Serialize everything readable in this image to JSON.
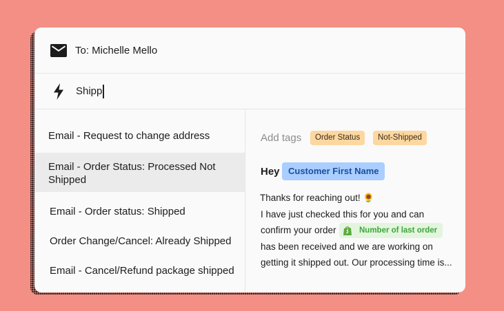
{
  "compose": {
    "to_label": "To: Michelle Mello",
    "search_value": "Shipp"
  },
  "templates": [
    {
      "label": "Email - Request to change address"
    },
    {
      "label": "Email - Order Status: Processed Not Shipped"
    },
    {
      "label": "Email - Order status: Shipped"
    },
    {
      "label": "Order Change/Cancel: Already Shipped"
    },
    {
      "label": "Email - Cancel/Refund package shipped"
    }
  ],
  "preview": {
    "tags_label": "Add tags",
    "tags": [
      "Order Status",
      "Not-Shipped"
    ],
    "greeting": "Hey",
    "customer_variable": "Customer First Name",
    "line1": "Thanks for reaching out! 🌻",
    "line2": "I have just checked this for you and can",
    "line3": "confirm your order",
    "order_variable": "Number of last order",
    "line4": "has been received and we are working on",
    "line5": "getting it shipped out. Our processing time is..."
  },
  "colors": {
    "background": "#f38f84",
    "tag": "#fcd79f",
    "customer_variable": "#a9ceff",
    "order_variable": "#e4f5df",
    "selected_row": "#ebebeb"
  },
  "icons": {
    "recipient": "mail-icon",
    "search": "lightning-icon",
    "order_variable": "shopify-bag-icon"
  }
}
